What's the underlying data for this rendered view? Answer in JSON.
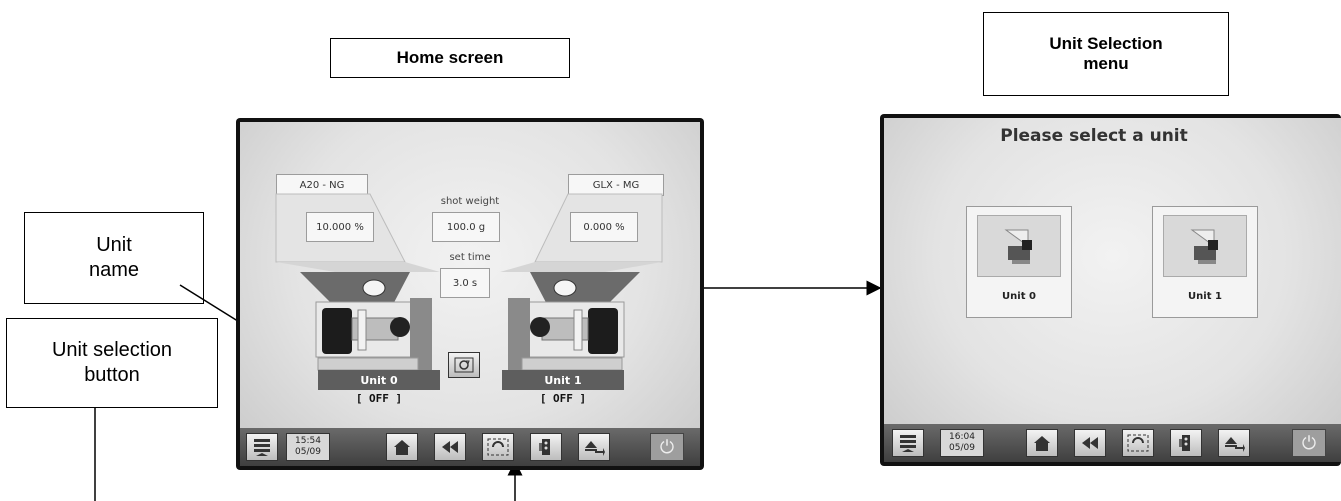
{
  "callouts": {
    "home_screen": "Home screen",
    "unit_selection_menu": "Unit Selection\nmenu",
    "unit_name": "Unit\nname",
    "unit_selection_button": "Unit selection\nbutton"
  },
  "home": {
    "left_material": "A20 - NG",
    "right_material": "GLX - MG",
    "left_percent": "10.000 %",
    "right_percent": "0.000 %",
    "shot_weight_label": "shot weight",
    "shot_weight_value": "100.0 g",
    "set_time_label": "set time",
    "set_time_value": "3.0 s",
    "unit0_name": "Unit 0",
    "unit1_name": "Unit 1",
    "unit0_status": "[  OFF  ]",
    "unit1_status": "[  OFF  ]",
    "clock_time": "15:54",
    "clock_date": "05/09"
  },
  "selection": {
    "title": "Please select a unit",
    "unit0_label": "Unit 0",
    "unit1_label": "Unit 1",
    "clock_time": "16:04",
    "clock_date": "05/09"
  },
  "icons": [
    "menu-icon",
    "home-icon",
    "rewind-icon",
    "unit-selection-icon",
    "settings-icon",
    "export-icon",
    "power-icon"
  ]
}
